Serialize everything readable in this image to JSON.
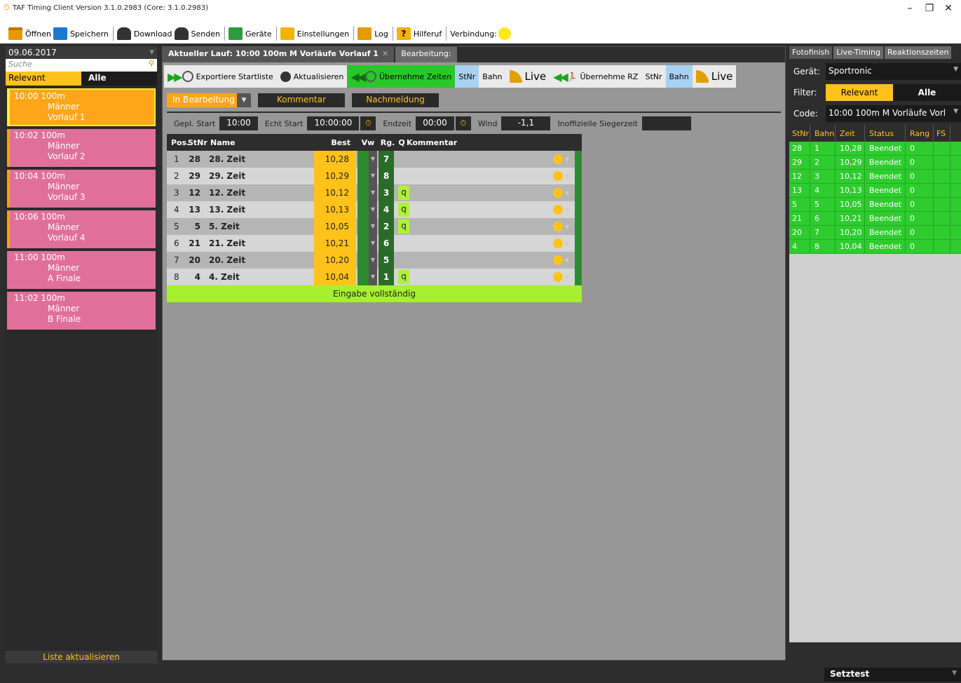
{
  "window": {
    "title": "TAF Timing Client Version 3.1.0.2983 (Core: 3.1.0.2983)",
    "minimize": "–",
    "restore": "❐",
    "close": "✕"
  },
  "toolbar": {
    "open": "Öffnen",
    "save": "Speichern",
    "download": "Download",
    "send": "Senden",
    "devices": "Geräte",
    "settings": "Einstellungen",
    "log": "Log",
    "help": "Hilferuf",
    "help_glyph": "?",
    "connection": "Verbindung:",
    "connection_color": "#ffe81a"
  },
  "left": {
    "date": "09.06.2017",
    "search_placeholder": "Suche",
    "filter_relevant": "Relevant",
    "filter_all": "Alle",
    "heats": [
      {
        "time": "10:00 100m",
        "gender": "Männer",
        "round": "Vorlauf 1"
      },
      {
        "time": "10:02 100m",
        "gender": "Männer",
        "round": "Vorlauf 2"
      },
      {
        "time": "10:04 100m",
        "gender": "Männer",
        "round": "Vorlauf 3"
      },
      {
        "time": "10:06 100m",
        "gender": "Männer",
        "round": "Vorlauf 4"
      },
      {
        "time": "11:00 100m",
        "gender": "Männer",
        "round": "A Finale"
      },
      {
        "time": "11:02 100m",
        "gender": "Männer",
        "round": "B Finale"
      }
    ],
    "refresh": "Liste aktualisieren"
  },
  "center": {
    "tab_active": "Aktueller Lauf: 10:00 100m  M Vorläufe Vorlauf 1",
    "tab_edit": "Bearbeitung:",
    "actions": {
      "export": "Exportiere Startliste",
      "refresh": "Aktualisieren",
      "take_times": "Übernehme Zeiten",
      "stnr": "StNr",
      "bahn": "Bahn",
      "live": "Live",
      "take_rz": "Übernehme RZ",
      "stnr2": "StNr",
      "bahn2": "Bahn",
      "live2": "Live"
    },
    "status": "In Bearbeitung",
    "comment_btn": "Kommentar",
    "late_btn": "Nachmeldung",
    "info": {
      "planned_label": "Gepl. Start",
      "planned": "10:00",
      "real_label": "Echt Start",
      "real": "10:00:00",
      "end_label": "Endzeit",
      "end": "00:00",
      "wind_label": "Wind",
      "wind": "-1,1",
      "winner_label": "Inoffizielle Siegerzeit",
      "winner": ""
    },
    "headers": {
      "pos": "Pos.",
      "stnr": "StNr",
      "name": "Name",
      "best": "Best",
      "vw": "Vw",
      "rg": "Rg.",
      "q": "Q",
      "comment": "Kommentar"
    },
    "rows": [
      {
        "pos": "1",
        "stnr": "28",
        "name": "28. Zeit",
        "best": "10,28",
        "rg": "7",
        "q": ""
      },
      {
        "pos": "2",
        "stnr": "29",
        "name": "29. Zeit",
        "best": "10,29",
        "rg": "8",
        "q": ""
      },
      {
        "pos": "3",
        "stnr": "12",
        "name": "12. Zeit",
        "best": "10,12",
        "rg": "3",
        "q": "q"
      },
      {
        "pos": "4",
        "stnr": "13",
        "name": "13. Zeit",
        "best": "10,13",
        "rg": "4",
        "q": "q"
      },
      {
        "pos": "5",
        "stnr": "5",
        "name": "5. Zeit",
        "best": "10,05",
        "rg": "2",
        "q": "q"
      },
      {
        "pos": "6",
        "stnr": "21",
        "name": "21. Zeit",
        "best": "10,21",
        "rg": "6",
        "q": ""
      },
      {
        "pos": "7",
        "stnr": "20",
        "name": "20. Zeit",
        "best": "10,20",
        "rg": "5",
        "q": ""
      },
      {
        "pos": "8",
        "stnr": "4",
        "name": "4. Zeit",
        "best": "10,04",
        "rg": "1",
        "q": "q"
      }
    ],
    "complete": "Eingabe vollständig"
  },
  "right": {
    "tabs": [
      "Fotofinish",
      "Live-Timing",
      "Reaktionszeiten"
    ],
    "device_label": "Gerät:",
    "device": "Sportronic",
    "filter_label": "Filter:",
    "filter_relevant": "Relevant",
    "filter_all": "Alle",
    "code_label": "Code:",
    "code": "10:00 100m  M Vorläufe Vorl",
    "headers": {
      "stnr": "StNr",
      "bahn": "Bahn",
      "zeit": "Zeit",
      "status": "Status",
      "rang": "Rang",
      "fs": "FS"
    },
    "rows": [
      {
        "stnr": "28",
        "bahn": "1",
        "zeit": "10,28",
        "status": "Beendet",
        "rang": "0"
      },
      {
        "stnr": "29",
        "bahn": "2",
        "zeit": "10,29",
        "status": "Beendet",
        "rang": "0"
      },
      {
        "stnr": "12",
        "bahn": "3",
        "zeit": "10,12",
        "status": "Beendet",
        "rang": "0"
      },
      {
        "stnr": "13",
        "bahn": "4",
        "zeit": "10,13",
        "status": "Beendet",
        "rang": "0"
      },
      {
        "stnr": "5",
        "bahn": "5",
        "zeit": "10,05",
        "status": "Beendet",
        "rang": "0"
      },
      {
        "stnr": "21",
        "bahn": "6",
        "zeit": "10,21",
        "status": "Beendet",
        "rang": "0"
      },
      {
        "stnr": "20",
        "bahn": "7",
        "zeit": "10,20",
        "status": "Beendet",
        "rang": "0"
      },
      {
        "stnr": "4",
        "bahn": "8",
        "zeit": "10,04",
        "status": "Beendet",
        "rang": "0"
      }
    ]
  },
  "bottom": {
    "mode": "Setztest"
  }
}
